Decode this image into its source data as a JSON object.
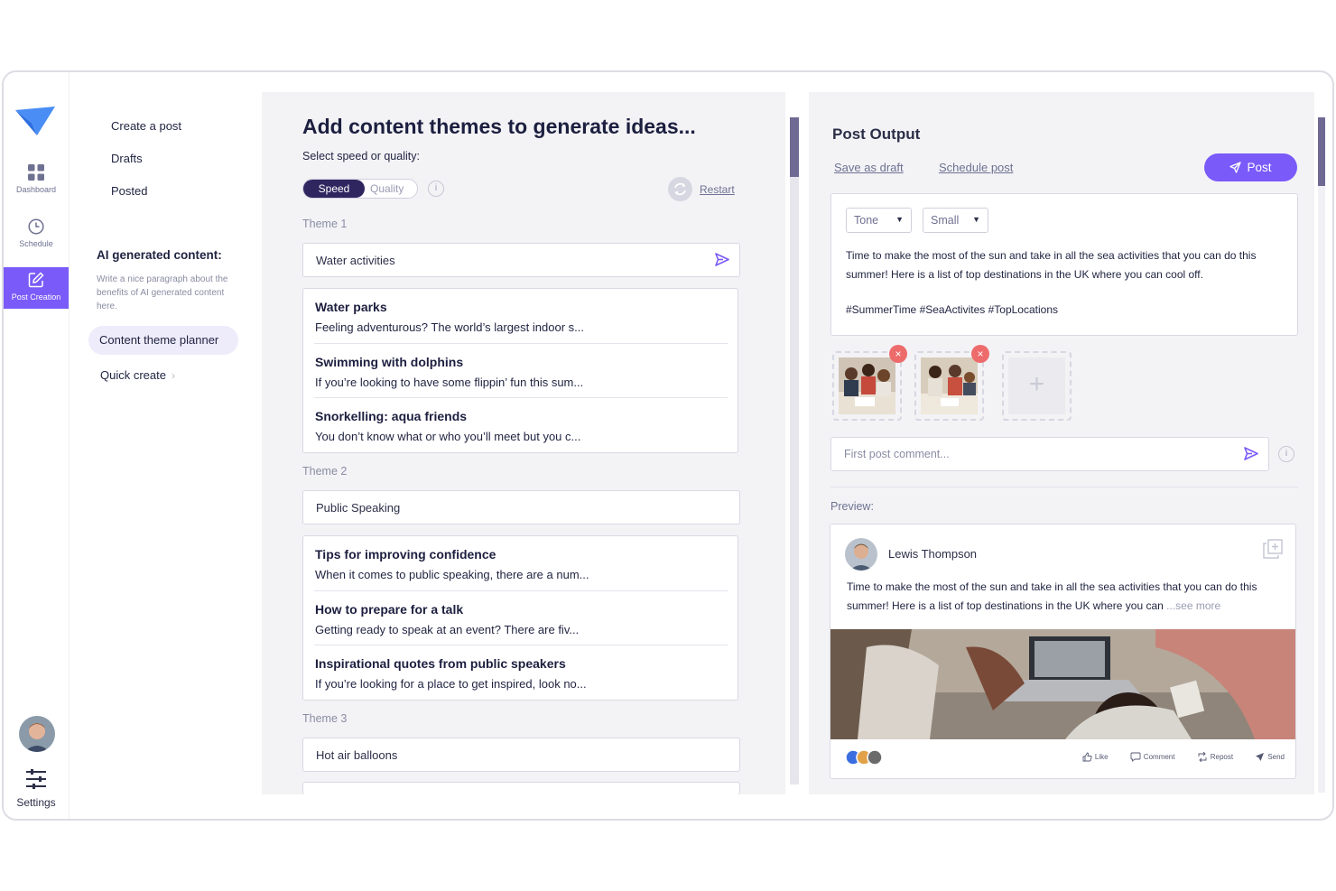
{
  "rail": {
    "dashboard": "Dashboard",
    "schedule": "Schedule",
    "post_creation": "Post Creation",
    "settings": "Settings"
  },
  "subnav": {
    "create": "Create a post",
    "drafts": "Drafts",
    "posted": "Posted",
    "ai_title": "AI generated content:",
    "ai_desc": "Write a nice paragraph about the benefits of AI generated content here.",
    "planner": "Content theme planner",
    "quick": "Quick create",
    "quick_chev": "›"
  },
  "main": {
    "title": "Add content themes to generate ideas...",
    "subtitle": "Select speed or quality:",
    "speed": "Speed",
    "quality": "Quality",
    "info": "i",
    "restart": "Restart",
    "themes": [
      {
        "label": "Theme 1",
        "input": "Water activities",
        "ideas": [
          {
            "title": "Water parks",
            "snippet": "Feeling adventurous? The world’s largest indoor s..."
          },
          {
            "title": "Swimming with dolphins",
            "snippet": "If you’re looking to have some flippin’ fun this sum..."
          },
          {
            "title": "Snorkelling: aqua friends",
            "snippet": "You don’t know what or who you’ll meet but you c..."
          }
        ]
      },
      {
        "label": "Theme 2",
        "input": "Public Speaking",
        "ideas": [
          {
            "title": "Tips for improving confidence",
            "snippet": "When it comes to public speaking, there are a num..."
          },
          {
            "title": "How to prepare for a talk",
            "snippet": "Getting ready to speak at an event? There are fiv..."
          },
          {
            "title": "Inspirational quotes from public speakers",
            "snippet": "If you’re looking for a place to get inspired, look no..."
          }
        ]
      },
      {
        "label": "Theme 3",
        "input": "Hot air balloons"
      }
    ]
  },
  "output": {
    "title": "Post Output",
    "save_draft": "Save as draft",
    "schedule": "Schedule post",
    "post": "Post",
    "tone": "Tone",
    "size": "Small",
    "body": "Time to make the most of the sun and take in all the sea activities that you can do this summer! Here is a list of top destinations in the UK where you can cool off.",
    "tags": "#SummerTime #SeaActivites #TopLocations",
    "remove": "×",
    "add_image": "+",
    "comment_placeholder": "First post comment...",
    "info": "i",
    "preview_label": "Preview:",
    "preview": {
      "name": "Lewis Thompson",
      "text": "Time to make the most of the sun and take in all the sea activities that you can do this summer! Here is a list of top destinations in the UK where you can ",
      "see_more": "...see more",
      "like": "Like",
      "comment": "Comment",
      "repost": "Repost",
      "send": "Send"
    }
  },
  "colors": {
    "accent": "#7a5af8",
    "toggle_active": "#2f2660",
    "remove_badge": "#ee6b6b",
    "panel_bg": "#f3f3f6"
  }
}
